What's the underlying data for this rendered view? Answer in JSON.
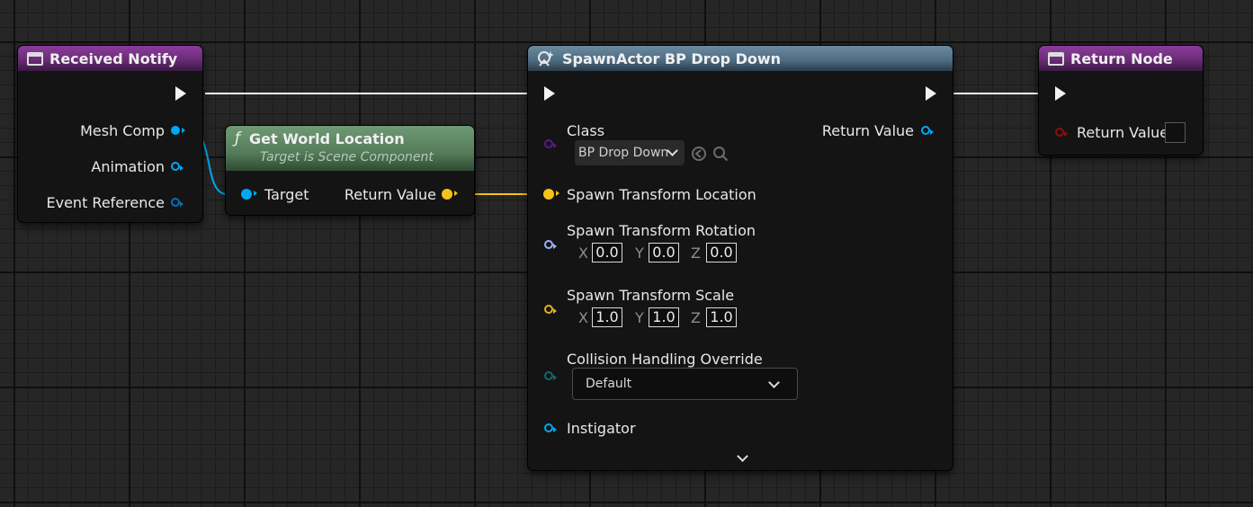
{
  "colors": {
    "exec": "#f2f2f2",
    "object_pin": "#00a8f2",
    "vector_pin": "#f5c21a",
    "rotator_pin": "#9db1ff",
    "transform_scale_pin": "#e0b020",
    "class_pin": "#5a1a8a",
    "enum_pin": "#0f6b6b",
    "return_pin_red": "#8a1010"
  },
  "received_notify": {
    "title": "Received Notify",
    "icon": "event-icon",
    "pins": [
      "Mesh Comp",
      "Animation",
      "Event Reference"
    ]
  },
  "get_world_location": {
    "title": "Get World Location",
    "subtitle": "Target is Scene Component",
    "icon": "function-icon",
    "function_glyph": "ƒ",
    "input_label": "Target",
    "output_label": "Return Value"
  },
  "spawn_actor": {
    "title": "SpawnActor BP Drop Down",
    "icon": "spawn-actor-icon",
    "class_label": "Class",
    "class_value": "BP Drop Down",
    "return_label": "Return Value",
    "location_label": "Spawn Transform Location",
    "rotation_label": "Spawn Transform Rotation",
    "rotation": {
      "x_label": "X",
      "x": "0.0",
      "y_label": "Y",
      "y": "0.0",
      "z_label": "Z",
      "z": "0.0"
    },
    "scale_label": "Spawn Transform Scale",
    "scale": {
      "x_label": "X",
      "x": "1.0",
      "y_label": "Y",
      "y": "1.0",
      "z_label": "Z",
      "z": "1.0"
    },
    "collision_label": "Collision Handling Override",
    "collision_value": "Default",
    "instigator_label": "Instigator",
    "expand_icon": "chevron-down-icon"
  },
  "return_node": {
    "title": "Return Node",
    "icon": "event-icon",
    "return_label": "Return Value",
    "return_checked": false
  }
}
